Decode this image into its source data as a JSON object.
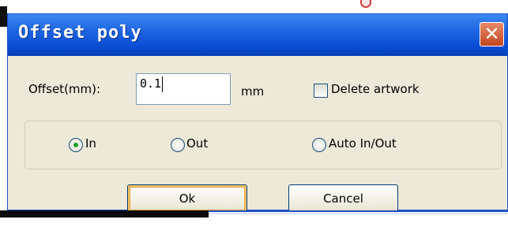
{
  "dialog": {
    "title": "Offset poly",
    "close_symbol": "✕",
    "offset_label": "Offset(mm):",
    "offset_value": "0.1",
    "unit_label": "mm",
    "delete_artwork_label": "Delete artwork",
    "delete_artwork_checked": false,
    "direction_options": [
      {
        "label": "In",
        "selected": true
      },
      {
        "label": "Out",
        "selected": false
      },
      {
        "label": "Auto In/Out",
        "selected": false
      }
    ],
    "ok_label": "Ok",
    "cancel_label": "Cancel"
  },
  "colors": {
    "titlebar": "#0a4fd6",
    "close_button": "#c2461f",
    "dialog_face": "#ece9d8",
    "radio_dot": "#21a121"
  },
  "icons": {
    "close": "close-icon",
    "background_mark": "red-circle-icon"
  }
}
